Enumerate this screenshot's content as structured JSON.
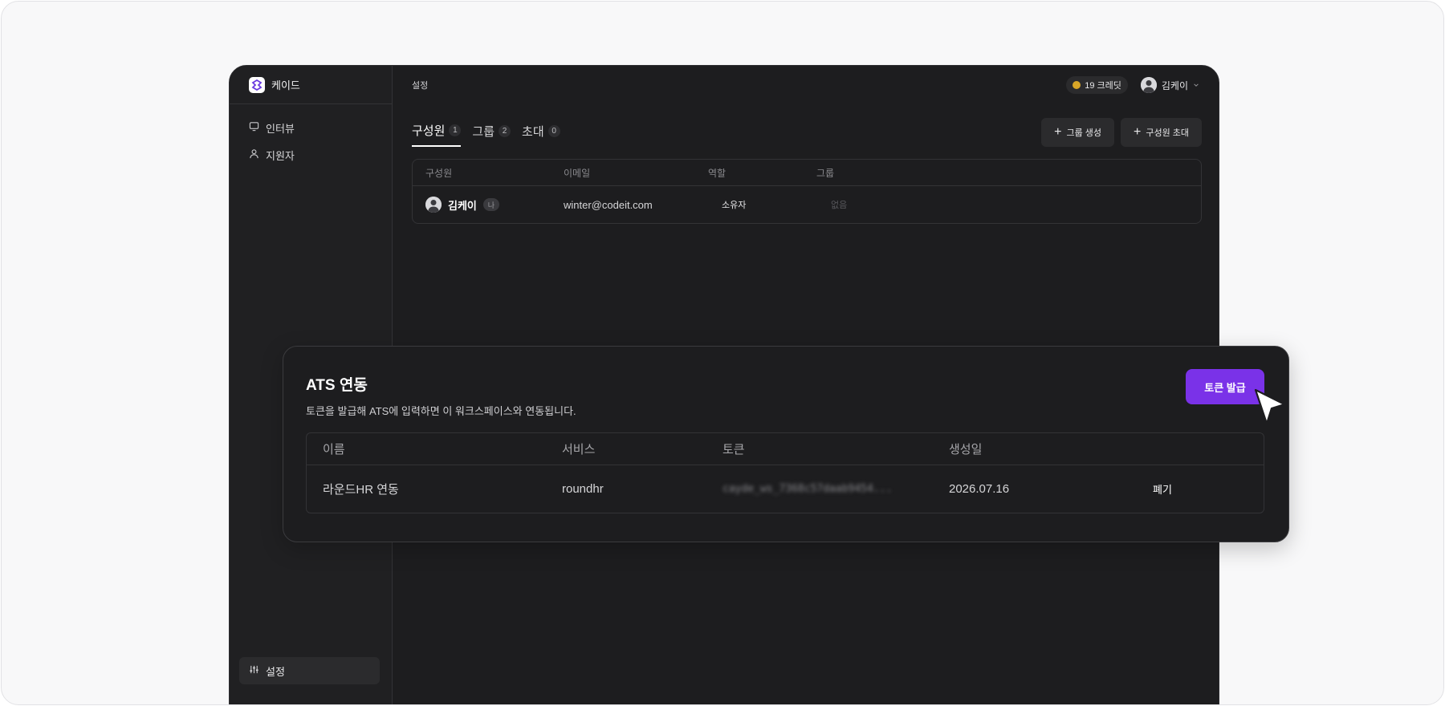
{
  "brand": {
    "name": "케이드"
  },
  "sidebar": {
    "items": [
      {
        "label": "인터뷰",
        "icon": "monitor-icon"
      },
      {
        "label": "지원자",
        "icon": "person-icon"
      }
    ],
    "bottom": {
      "label": "설정",
      "icon": "sliders-icon"
    }
  },
  "topbar": {
    "breadcrumb": "설정",
    "credits": "19 크레딧",
    "user": "김케이"
  },
  "tabs": [
    {
      "label": "구성원",
      "count": "1",
      "active": true
    },
    {
      "label": "그룹",
      "count": "2",
      "active": false
    },
    {
      "label": "초대",
      "count": "0",
      "active": false
    }
  ],
  "actions": {
    "create_group": "그룹 생성",
    "invite_member": "구성원 초대"
  },
  "members_table": {
    "headers": [
      "구성원",
      "이메일",
      "역할",
      "그룹"
    ],
    "rows": [
      {
        "name": "김케이",
        "badge": "나",
        "email": "winter@codeit.com",
        "role": "소유자",
        "group": "없음"
      }
    ]
  },
  "ats": {
    "title": "ATS 연동",
    "description": "토큰을 발급해 ATS에 입력하면 이 워크스페이스와 연동됩니다.",
    "issue_button": "토큰 발급",
    "headers": [
      "이름",
      "서비스",
      "토큰",
      "생성일"
    ],
    "rows": [
      {
        "name": "라운드HR 연동",
        "service": "roundhr",
        "token": "cayde_ws_7368c57daab9454...",
        "created": "2026.07.16",
        "action": "폐기"
      }
    ]
  },
  "colors": {
    "accent": "#7a32e8",
    "coin": "#d9a627",
    "background": "#1d1d1f"
  }
}
